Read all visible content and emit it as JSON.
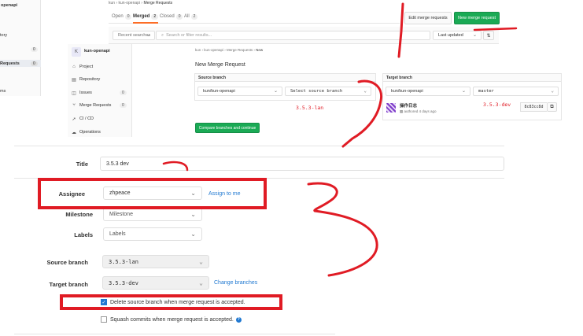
{
  "bg_sidebar": {
    "title": "openapi",
    "items": [
      {
        "label": "tory",
        "count": ""
      },
      {
        "label": "",
        "count": "0"
      },
      {
        "label": "Requests",
        "count": "0"
      },
      {
        "label": "ms",
        "count": ""
      }
    ]
  },
  "top_page": {
    "breadcrumb": [
      "kun",
      "kun-openapi",
      "Merge Requests"
    ],
    "tabs": [
      {
        "label": "Open",
        "count": "0"
      },
      {
        "label": "Merged",
        "count": "2"
      },
      {
        "label": "Closed",
        "count": "0"
      },
      {
        "label": "All",
        "count": "2"
      }
    ],
    "edit_button": "Edit merge requests",
    "new_button": "New merge request",
    "recent_searches": "Recent searches",
    "search_placeholder": "Search or filter results...",
    "sort_value": "Last updated"
  },
  "sidebar": {
    "project_initial": "K",
    "project_name": "kun-openapi",
    "items": [
      {
        "label": "Project",
        "icon": "home-icon",
        "count": ""
      },
      {
        "label": "Repository",
        "icon": "book-icon",
        "count": ""
      },
      {
        "label": "Issues",
        "icon": "issues-icon",
        "count": "0"
      },
      {
        "label": "Merge Requests",
        "icon": "merge-icon",
        "count": "0"
      },
      {
        "label": "CI / CD",
        "icon": "rocket-icon",
        "count": ""
      },
      {
        "label": "Operations",
        "icon": "cloud-icon",
        "count": ""
      }
    ]
  },
  "new_mr": {
    "breadcrumb": [
      "kun",
      "kun-openapi",
      "Merge Requests",
      "New"
    ],
    "heading": "New Merge Request",
    "source_label": "Source branch",
    "target_label": "Target branch",
    "source_project": "kun/kun-openapi",
    "source_branch_placeholder": "Select source branch",
    "target_project": "kun/kun-openapi",
    "target_branch": "master",
    "commit_title": "操作日志",
    "commit_meta": "authored 4 days ago",
    "commit_sha": "8c83cc8d",
    "annotation_left": "3.5.3-lan",
    "annotation_right": "3.5.3-dev",
    "compare_button": "Compare branches and continue"
  },
  "form": {
    "title_label": "Title",
    "title_value": "3.5.3 dev",
    "assignee_label": "Assignee",
    "assignee_value": "zhpeace",
    "assign_to_me": "Assign to me",
    "milestone_label": "Milestone",
    "milestone_value": "Milestone",
    "labels_label": "Labels",
    "labels_value": "Labels",
    "source_label": "Source branch",
    "source_value": "3.5.3-lan",
    "target_label": "Target branch",
    "target_value": "3.5.3-dev",
    "change_branches": "Change branches",
    "delete_source": "Delete source branch when merge request is accepted.",
    "delete_checked": true,
    "squash": "Squash commits when merge request is accepted.",
    "squash_checked": false
  },
  "colors": {
    "accent_green": "#1aaa55",
    "link_blue": "#1f78d1",
    "annotation_red": "#e01b24"
  }
}
